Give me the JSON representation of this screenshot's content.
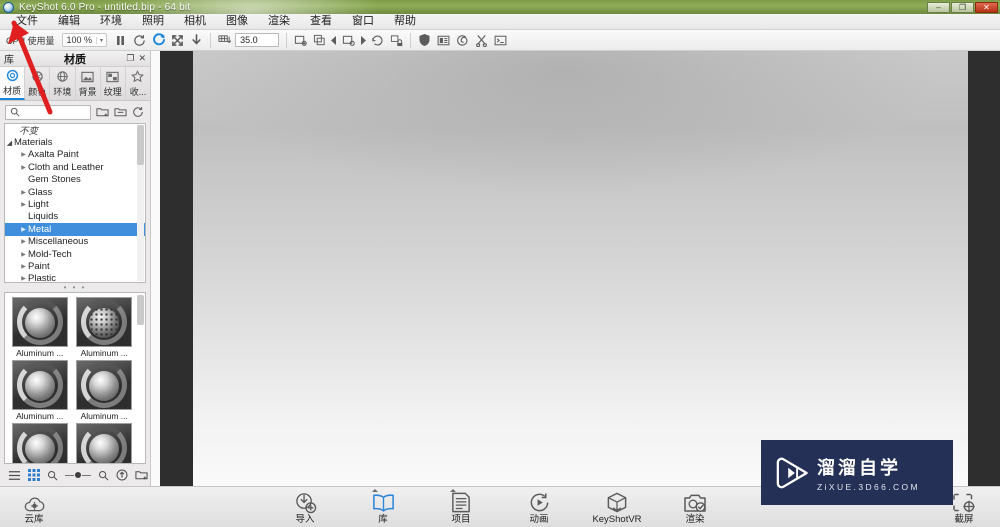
{
  "window": {
    "title": "KeyShot 6.0 Pro  - untitled.bip  - 64 bit",
    "app_icon": "keyshot-orb-icon",
    "controls": {
      "minimize": "–",
      "maximize": "❐",
      "close": "✕"
    }
  },
  "menubar": {
    "items": [
      {
        "label": "文件",
        "name": "menu-file"
      },
      {
        "label": "编辑",
        "name": "menu-edit"
      },
      {
        "label": "环境",
        "name": "menu-environment"
      },
      {
        "label": "照明",
        "name": "menu-lighting"
      },
      {
        "label": "相机",
        "name": "menu-camera"
      },
      {
        "label": "图像",
        "name": "menu-image"
      },
      {
        "label": "渲染",
        "name": "menu-render"
      },
      {
        "label": "查看",
        "name": "menu-view"
      },
      {
        "label": "窗口",
        "name": "menu-window"
      },
      {
        "label": "帮助",
        "name": "menu-help"
      }
    ]
  },
  "toolbar": {
    "cpu_label": "CPU 使用量",
    "cpu_percent": "100 %",
    "caret": "▾",
    "ray_bounces": "35.0",
    "icons": [
      {
        "name": "pause-icon",
        "glyph": "❙❙"
      },
      {
        "name": "refresh-icon",
        "glyph": "↻"
      },
      {
        "name": "realtime-render-icon",
        "glyph": "C"
      },
      {
        "name": "move-tool-icon",
        "glyph": "✛"
      },
      {
        "name": "drop-to-ground-icon",
        "glyph": "⬇"
      },
      {
        "name": "ground-grid-icon",
        "glyph": "▦"
      },
      {
        "name": "perspective-camera-icon",
        "glyph": "◲"
      },
      {
        "name": "copy-camera-icon",
        "glyph": "▣"
      },
      {
        "name": "camera-prev-icon",
        "glyph": "◂"
      },
      {
        "name": "camera-view-icon",
        "glyph": "◲"
      },
      {
        "name": "camera-next-icon",
        "glyph": "▸"
      },
      {
        "name": "orbit-reset-icon",
        "glyph": "↺"
      },
      {
        "name": "lock-camera-icon",
        "glyph": "🔒"
      },
      {
        "name": "shield-icon",
        "glyph": "⛊"
      },
      {
        "name": "split-view-icon",
        "glyph": "▤"
      },
      {
        "name": "spiral-icon",
        "glyph": "◌"
      },
      {
        "name": "scissors-icon",
        "glyph": "✂"
      },
      {
        "name": "script-console-icon",
        "glyph": "▤"
      }
    ]
  },
  "library_panel": {
    "dock_label": "库",
    "title": "材质",
    "actions": [
      {
        "name": "undock-icon",
        "glyph": "❐"
      },
      {
        "name": "close-icon",
        "glyph": "✕"
      }
    ],
    "tabs": [
      {
        "label": "材质",
        "name": "tab-materials",
        "icon": "sphere-icon",
        "active": true
      },
      {
        "label": "颜色",
        "name": "tab-colors",
        "icon": "color-wheel-icon",
        "active": false
      },
      {
        "label": "环境",
        "name": "tab-environments",
        "icon": "globe-icon",
        "active": false
      },
      {
        "label": "背景",
        "name": "tab-backgrounds",
        "icon": "image-icon",
        "active": false
      },
      {
        "label": "纹理",
        "name": "tab-textures",
        "icon": "texture-icon",
        "active": false
      },
      {
        "label": "收...",
        "name": "tab-favorites",
        "icon": "star-icon",
        "active": false
      }
    ],
    "search": {
      "placeholder": "",
      "value": "",
      "icon": "search-icon"
    },
    "search_actions": [
      {
        "name": "import-folder-icon",
        "glyph": "🗀"
      },
      {
        "name": "add-folder-icon",
        "glyph": "🗀"
      },
      {
        "name": "refresh-library-icon",
        "glyph": "↻"
      }
    ],
    "tree": {
      "header": "不变",
      "items": [
        {
          "label": "Materials",
          "depth": 0,
          "expanded": true,
          "selected": false
        },
        {
          "label": "Axalta Paint",
          "depth": 1,
          "expandable": true,
          "selected": false
        },
        {
          "label": "Cloth and Leather",
          "depth": 1,
          "expandable": true,
          "selected": false
        },
        {
          "label": "Gem Stones",
          "depth": 1,
          "expandable": false,
          "selected": false
        },
        {
          "label": "Glass",
          "depth": 1,
          "expandable": true,
          "selected": false
        },
        {
          "label": "Light",
          "depth": 1,
          "expandable": true,
          "selected": false
        },
        {
          "label": "Liquids",
          "depth": 1,
          "expandable": false,
          "selected": false
        },
        {
          "label": "Metal",
          "depth": 1,
          "expandable": true,
          "selected": true
        },
        {
          "label": "Miscellaneous",
          "depth": 1,
          "expandable": true,
          "selected": false
        },
        {
          "label": "Mold-Tech",
          "depth": 1,
          "expandable": true,
          "selected": false
        },
        {
          "label": "Paint",
          "depth": 1,
          "expandable": true,
          "selected": false
        },
        {
          "label": "Plastic",
          "depth": 1,
          "expandable": true,
          "selected": false
        }
      ]
    },
    "splitter": "• • •",
    "thumbnails": [
      {
        "label": "Aluminum ...",
        "style": "swirl"
      },
      {
        "label": "Aluminum ...",
        "style": "perforated"
      },
      {
        "label": "Aluminum ...",
        "style": "swirl"
      },
      {
        "label": "Aluminum ...",
        "style": "swirl"
      },
      {
        "label": "",
        "style": "swirl"
      },
      {
        "label": "",
        "style": "swirl"
      }
    ],
    "footer_tools": [
      {
        "name": "list-view-icon",
        "glyph": "☰",
        "active": false
      },
      {
        "name": "grid-view-icon",
        "glyph": "▦",
        "active": true
      },
      {
        "name": "zoom-out-icon",
        "glyph": "🔍",
        "active": false
      },
      {
        "name": "thumbnail-size-slider",
        "glyph": "slider",
        "active": false
      },
      {
        "name": "zoom-in-icon",
        "glyph": "🔍",
        "active": false
      },
      {
        "name": "upload-icon",
        "glyph": "⬆",
        "active": false
      },
      {
        "name": "add-to-library-icon",
        "glyph": "🗀",
        "active": false
      }
    ]
  },
  "viewport": {
    "name": "render-viewport",
    "scene": "untitled.bip"
  },
  "watermark": {
    "cn": "溜溜自学",
    "en": "ZiXUE.3D66.COM",
    "logo": "play-button-logo",
    "bg_color": "#243056"
  },
  "bottombar": {
    "left": {
      "label": "云库",
      "name": "cloud-library-button",
      "icon": "cloud-icon"
    },
    "items": [
      {
        "label": "导入",
        "name": "import-button",
        "icon": "import-icon",
        "active": false,
        "caret": false
      },
      {
        "label": "库",
        "name": "library-button",
        "icon": "book-icon",
        "active": true,
        "caret": true
      },
      {
        "label": "项目",
        "name": "project-button",
        "icon": "document-icon",
        "active": false,
        "caret": true
      },
      {
        "label": "动画",
        "name": "animation-button",
        "icon": "play-circle-icon",
        "active": false,
        "caret": false
      },
      {
        "label": "KeyShotVR",
        "name": "keyshotvr-button",
        "icon": "cube-icon",
        "active": false,
        "caret": false
      },
      {
        "label": "渲染",
        "name": "render-button",
        "icon": "camera-check-icon",
        "active": false,
        "caret": false
      }
    ],
    "right": {
      "label": "截屏",
      "name": "screenshot-button",
      "icon": "screenshot-icon"
    }
  },
  "annotation": {
    "arrow_color": "#e02020",
    "points_to": "menu-file"
  }
}
